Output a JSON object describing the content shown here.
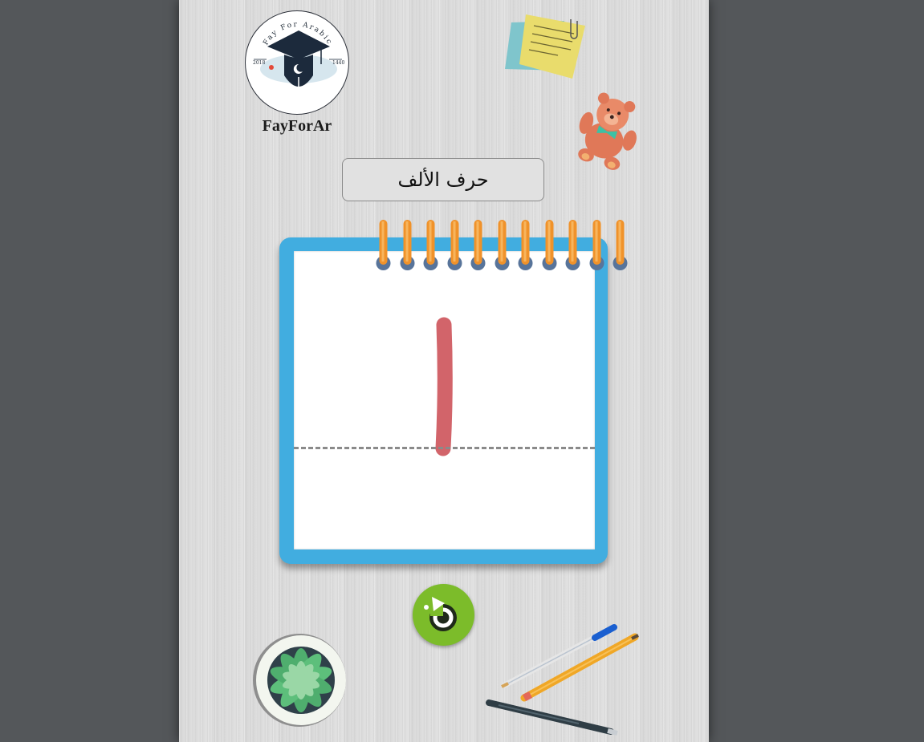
{
  "brand": {
    "logo_arc_text": "Fay For Arabic",
    "logo_year_left": "2018",
    "logo_year_right": "1440",
    "caption": "FayForAr"
  },
  "lesson": {
    "title": "حرف الألف",
    "letter": "ا"
  },
  "controls": {
    "reset_icon": "refresh-icon"
  },
  "decor": {
    "items": [
      "sticky-notes",
      "teddy-bear",
      "succulent-plant",
      "pens-and-pencil"
    ]
  },
  "colors": {
    "background": "#54575a",
    "page": "#dcdcdc",
    "notepad_frame": "#41ade0",
    "ring": "#f0922a",
    "letter_stroke": "#d2646a",
    "reset_button": "#7cbc2a"
  }
}
